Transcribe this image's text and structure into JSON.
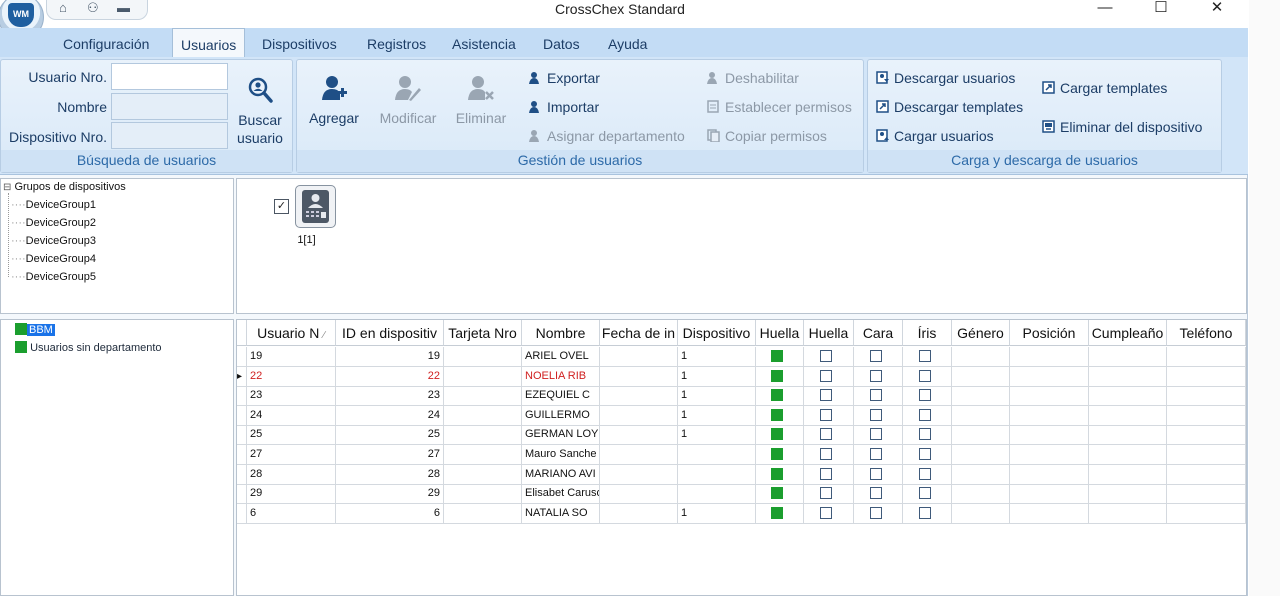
{
  "window": {
    "title": "CrossChex Standard",
    "minimize": "—",
    "maximize": "☐",
    "close": "✕"
  },
  "logo_text": "WM",
  "quick_access": {
    "home": "⌂",
    "user": "⚇",
    "save": "▬"
  },
  "menu": {
    "tabs": [
      "Configuración",
      "Usuarios",
      "Dispositivos",
      "Registros",
      "Asistencia",
      "Datos",
      "Ayuda"
    ],
    "active_index": 1
  },
  "search_group": {
    "user_no_label": "Usuario Nro.",
    "name_label": "Nombre",
    "device_no_label": "Dispositivo Nro.",
    "user_no_value": "",
    "name_value": "",
    "device_no_value": "",
    "search_btn_line1": "Buscar",
    "search_btn_line2": "usuario",
    "group_label": "Búsqueda de usuarios"
  },
  "manage_group": {
    "add": "Agregar",
    "modify": "Modificar",
    "delete": "Eliminar",
    "export": "Exportar",
    "import": "Importar",
    "assign_dept": "Asignar departamento",
    "disable": "Deshabilitar",
    "set_perms": "Establecer permisos",
    "copy_perms": "Copiar permisos",
    "group_label": "Gestión de usuarios"
  },
  "load_group": {
    "download_users": "Descargar usuarios",
    "download_templates": "Descargar templates",
    "upload_users": "Cargar usuarios",
    "upload_templates": "Cargar templates",
    "delete_from_device": "Eliminar del dispositivo",
    "group_label": "Carga y descarga de usuarios"
  },
  "device_tree": {
    "root": "Grupos de dispositivos",
    "expander": "⊟",
    "groups": [
      "DeviceGroup1",
      "DeviceGroup2",
      "DeviceGroup3",
      "DeviceGroup4",
      "DeviceGroup5"
    ]
  },
  "device_panel": {
    "checkbox": "✓",
    "device_label": "1[1]"
  },
  "dept_tree": {
    "items": [
      "BBM",
      "Usuarios sin departamento"
    ]
  },
  "grid": {
    "row_indicator": "▸",
    "sort_glyph": "∕",
    "columns": [
      "Usuario N",
      "ID en dispositiv",
      "Tarjeta Nro",
      "Nombre",
      "Fecha de in",
      "Dispositivo",
      "Huella",
      "Huella",
      "Cara",
      "Íris",
      "Género",
      "Posición",
      "Cumpleaño",
      "Teléfono"
    ],
    "rows": [
      {
        "user_no": "19",
        "device_id": "19",
        "name": "ARIEL OVEL",
        "device": "1",
        "selected": false
      },
      {
        "user_no": "22",
        "device_id": "22",
        "name": "NOELIA RIB",
        "device": "1",
        "selected": true
      },
      {
        "user_no": "23",
        "device_id": "23",
        "name": "EZEQUIEL C",
        "device": "1",
        "selected": false
      },
      {
        "user_no": "24",
        "device_id": "24",
        "name": "GUILLERMO",
        "device": "1",
        "selected": false
      },
      {
        "user_no": "25",
        "device_id": "25",
        "name": "GERMAN LOY",
        "device": "1",
        "selected": false
      },
      {
        "user_no": "27",
        "device_id": "27",
        "name": "Mauro Sanche",
        "device": "",
        "selected": false
      },
      {
        "user_no": "28",
        "device_id": "28",
        "name": "MARIANO AVI",
        "device": "",
        "selected": false
      },
      {
        "user_no": "29",
        "device_id": "29",
        "name": "Elisabet Caruso",
        "device": "",
        "selected": false
      },
      {
        "user_no": "6",
        "device_id": "6",
        "name": "NATALIA SO",
        "device": "1",
        "selected": false
      }
    ]
  },
  "colors": {
    "accent": "#2d6aa8",
    "ribbon": "#d2e5f8",
    "menubar": "#c3dcf5",
    "green": "#1b9e2e",
    "selected_text": "#d02020"
  }
}
